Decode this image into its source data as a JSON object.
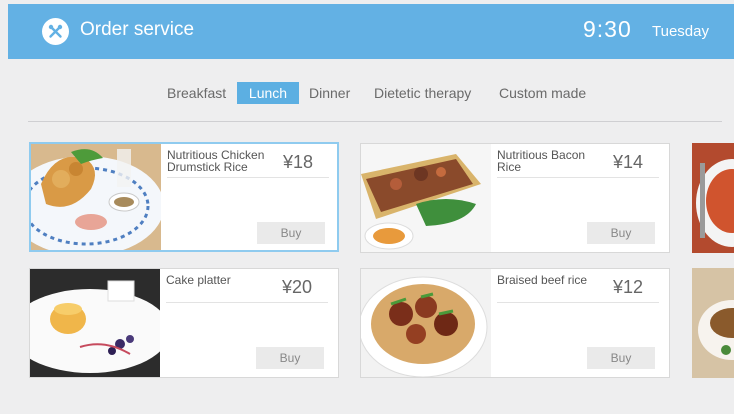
{
  "header": {
    "title": "Order service",
    "time": "9:30",
    "day": "Tuesday"
  },
  "tabs": [
    {
      "label": "Breakfast",
      "active": false
    },
    {
      "label": "Lunch",
      "active": true
    },
    {
      "label": "Dinner",
      "active": false
    },
    {
      "label": "Dietetic therapy",
      "active": false
    },
    {
      "label": "Custom made",
      "active": false
    }
  ],
  "items": [
    {
      "name": "Nutritious Chicken Drumstick Rice",
      "price": "¥18",
      "buy_label": "Buy",
      "selected": true
    },
    {
      "name": "Nutritious Bacon Rice",
      "price": "¥14",
      "buy_label": "Buy",
      "selected": false
    },
    {
      "name": "Cake platter",
      "price": "¥20",
      "buy_label": "Buy",
      "selected": false
    },
    {
      "name": "Braised beef rice",
      "price": "¥12",
      "buy_label": "Buy",
      "selected": false
    }
  ],
  "colors": {
    "header": "#63b1e4",
    "active_tab": "#5cafe2",
    "selected_border": "#8fcbef"
  }
}
